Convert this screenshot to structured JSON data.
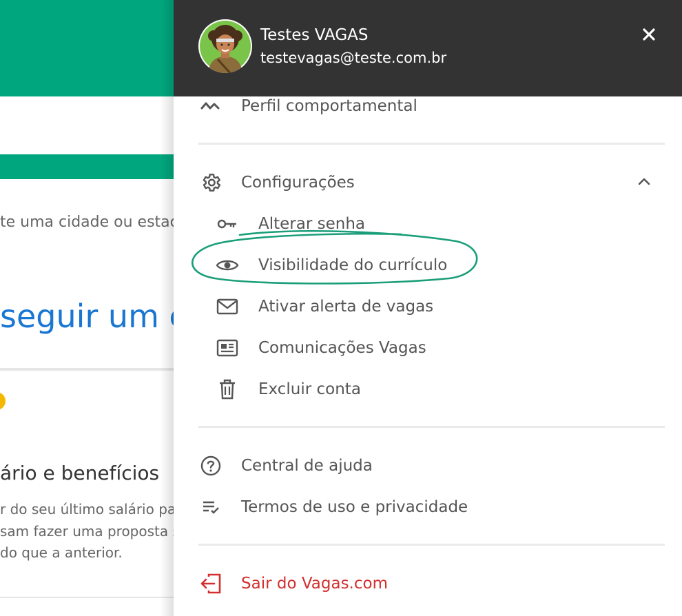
{
  "background": {
    "search_placeholder_fragment": "te uma cidade ou estac",
    "headline_fragment": "seguir um en",
    "subtitle_fragment": "ário e benefícios",
    "desc_lines": [
      "r do seu último salário par",
      "sam fazer uma proposta sa",
      " do que a anterior."
    ]
  },
  "drawer": {
    "user": {
      "name": "Testes VAGAS",
      "email": "testevagas@teste.com.br"
    },
    "close_icon": "close-icon",
    "items": {
      "profile": {
        "label": "Perfil comportamental",
        "icon": "behavior-wave-icon"
      },
      "settings": {
        "label": "Configurações",
        "icon": "gear-icon",
        "expanded": true
      },
      "change_password": {
        "label": "Alterar senha",
        "icon": "key-icon"
      },
      "visibility": {
        "label": "Visibilidade do currículo",
        "icon": "eye-icon"
      },
      "job_alert": {
        "label": "Ativar alerta de vagas",
        "icon": "mail-icon"
      },
      "communications": {
        "label": "Comunicações Vagas",
        "icon": "newspaper-icon"
      },
      "delete_account": {
        "label": "Excluir conta",
        "icon": "trash-icon"
      },
      "help": {
        "label": "Central de ajuda",
        "icon": "help-circle-icon"
      },
      "terms": {
        "label": "Termos de uso e privacidade",
        "icon": "list-check-icon"
      },
      "logout": {
        "label": "Sair do Vagas.com",
        "icon": "logout-icon"
      }
    }
  },
  "colors": {
    "brand_green": "#00a67d",
    "header_dark": "#333333",
    "link_blue": "#1976d2",
    "logout_red": "#d32f2f",
    "annotation_green": "#1a9e7a"
  }
}
